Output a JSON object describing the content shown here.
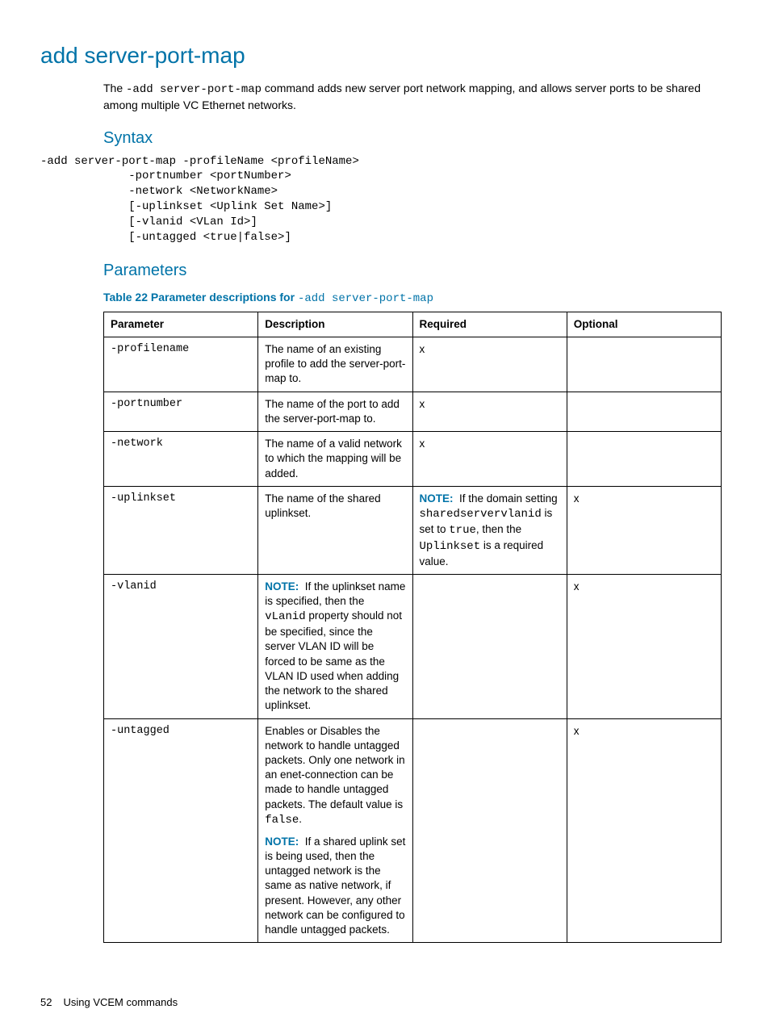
{
  "title": "add server-port-map",
  "intro_pre": "The ",
  "intro_cmd": "-add server-port-map",
  "intro_post": " command adds new server port network mapping, and allows server ports to be shared among multiple VC Ethernet networks.",
  "syntax_heading": "Syntax",
  "syntax_code": "-add server-port-map -profileName <profileName>\n             -portnumber <portNumber>\n             -network <NetworkName>\n             [-uplinkset <Uplink Set Name>]\n             [-vlanid <VLan Id>]\n             [-untagged <true|false>]",
  "params_heading": "Parameters",
  "table_caption_prefix": "Table 22 Parameter descriptions for ",
  "table_caption_cmd": "-add server-port-map",
  "columns": {
    "parameter": "Parameter",
    "description": "Description",
    "required": "Required",
    "optional": "Optional"
  },
  "rows": {
    "profilename": {
      "param": "-profilename",
      "desc": "The name of an existing profile to add the server-port-map to.",
      "required": "x",
      "optional": ""
    },
    "portnumber": {
      "param": "-portnumber",
      "desc": "The name of the port to add the server-port-map to.",
      "required": "x",
      "optional": ""
    },
    "network": {
      "param": "-network",
      "desc": "The name of a valid network to which the mapping will be added.",
      "required": "x",
      "optional": ""
    },
    "uplinkset": {
      "param": "-uplinkset",
      "desc": "The name of the shared uplinkset.",
      "req_note_label": "NOTE:",
      "req_note_1": "If the domain setting ",
      "req_note_code1": "sharedservervlanid",
      "req_note_2": " is set to ",
      "req_note_code2": "true",
      "req_note_3": ", then the ",
      "req_note_code3": "Uplinkset",
      "req_note_4": " is a required value.",
      "optional": "x"
    },
    "vlanid": {
      "param": "-vlanid",
      "note_label": "NOTE:",
      "desc_1": "If the uplinkset name is specified, then the ",
      "desc_code": "vLanid",
      "desc_2": " property should not be specified, since the server VLAN ID will be forced to be same as the VLAN ID used when adding the network to the shared uplinkset.",
      "required": "",
      "optional": "x"
    },
    "untagged": {
      "param": "-untagged",
      "desc_1": "Enables or Disables the network to handle untagged packets. Only one network in an enet-connection can be made to handle untagged packets. The default value is ",
      "desc_code": "false",
      "desc_2": ".",
      "note_label": "NOTE:",
      "note_text": "If a shared uplink set is being used, then the untagged network is the same as native network, if present. However, any other network can be configured to handle untagged packets.",
      "required": "",
      "optional": "x"
    }
  },
  "footer": {
    "page": "52",
    "section": "Using VCEM commands"
  }
}
